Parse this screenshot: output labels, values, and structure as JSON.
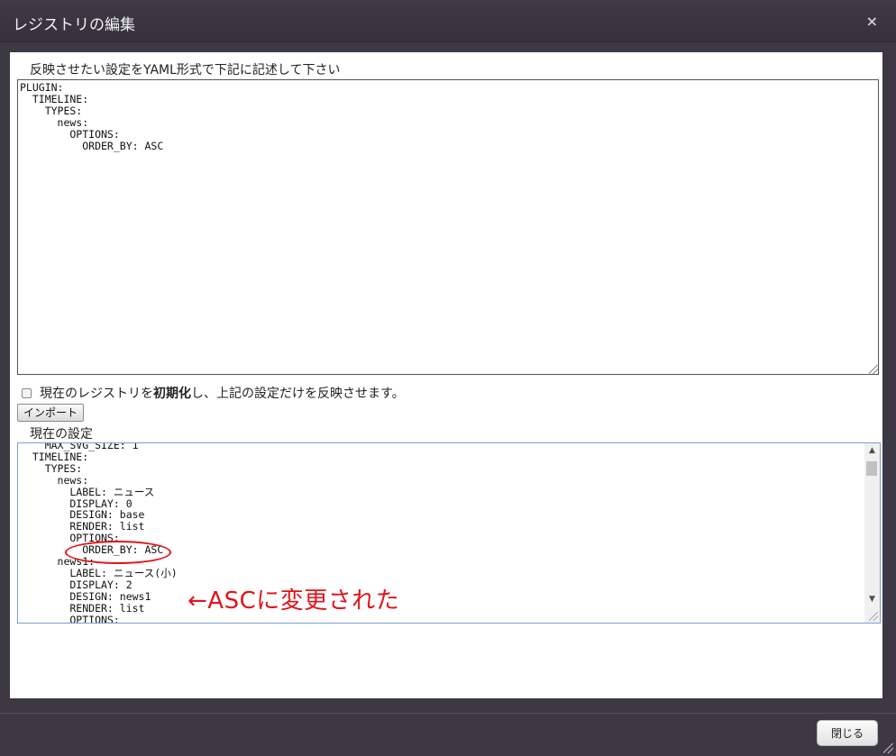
{
  "dialog": {
    "title": "レジストリの編集",
    "close_icon": "×"
  },
  "form": {
    "input_label": "反映させたい設定をYAML形式で下記に記述して下さい",
    "yaml_input": "PLUGIN:\n  TIMELINE:\n    TYPES:\n      news:\n        OPTIONS:\n          ORDER_BY: ASC",
    "reset_checkbox": {
      "label_before": "現在のレジストリを",
      "label_bold": "初期化",
      "label_after": "し、上記の設定だけを反映させます。",
      "checked": false
    },
    "import_button": "インポート",
    "current_label": "現在の設定",
    "current_settings": "    MAX_SVG_SIZE: 1\n  TIMELINE:\n    TYPES:\n      news:\n        LABEL: ニュース\n        DISPLAY: 0\n        DESIGN: base\n        RENDER: list\n        OPTIONS:\n          ORDER_BY: ASC\n      news1:\n        LABEL: ニュース(小)\n        DISPLAY: 2\n        DESIGN: news1\n        RENDER: list\n        OPTIONS:"
  },
  "annotation": {
    "text": "←ASCに変更された",
    "color": "#e0141a"
  },
  "footer": {
    "close_button": "閉じる"
  },
  "icons": [
    "close-icon",
    "scroll-up-icon",
    "scroll-down-icon",
    "resize-grip-icon"
  ]
}
